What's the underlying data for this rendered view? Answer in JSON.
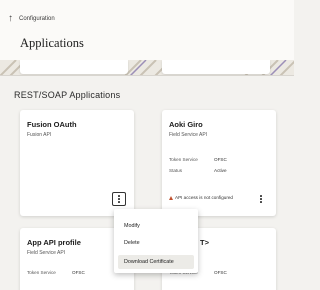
{
  "header": {
    "breadcrumb": "Configuration",
    "title": "Applications"
  },
  "section": {
    "title": "REST/SOAP Applications"
  },
  "cards": [
    {
      "title": "Fusion OAuth",
      "subtitle": "Fusion API"
    },
    {
      "title": "Aoki Giro",
      "subtitle": "Field Service API",
      "meta": [
        {
          "label": "Token Service",
          "value": "OFSC"
        },
        {
          "label": "Status",
          "value": "Active"
        }
      ],
      "warning": "API access is not configured"
    },
    {
      "title": "App API profile",
      "subtitle": "Field Service API",
      "meta": [
        {
          "label": "Token Service",
          "value": "OFSC"
        }
      ]
    },
    {
      "title": "T>",
      "subtitle": "",
      "meta": [
        {
          "label": "Token Service",
          "value": "OFSC"
        }
      ]
    }
  ],
  "menu": {
    "items": [
      "Modify",
      "Delete",
      "Download Certificate"
    ]
  }
}
